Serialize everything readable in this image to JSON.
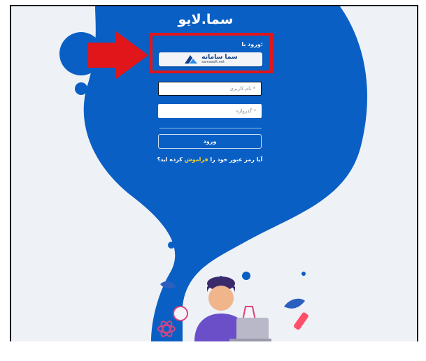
{
  "app": {
    "brand": "سما.لایو"
  },
  "login": {
    "login_with_label": "ورود با:",
    "provider": {
      "name_fa": "سما سامانه",
      "name_en": "samasoft.net"
    },
    "username_placeholder": "نام کاربری *",
    "password_placeholder": "گذرواژه *",
    "submit_label": "ورود",
    "forgot_prefix": "آیا رمز عبور خود را",
    "forgot_link": "فراموش",
    "forgot_suffix": "کرده اید؟"
  },
  "colors": {
    "brand_blue": "#0a5fc4",
    "accent_yellow": "#ffd21f",
    "highlight_red": "#e0161b",
    "background": "#eef1f6"
  },
  "icons": [
    "arrow-right-icon",
    "samasoft-logo-icon"
  ]
}
